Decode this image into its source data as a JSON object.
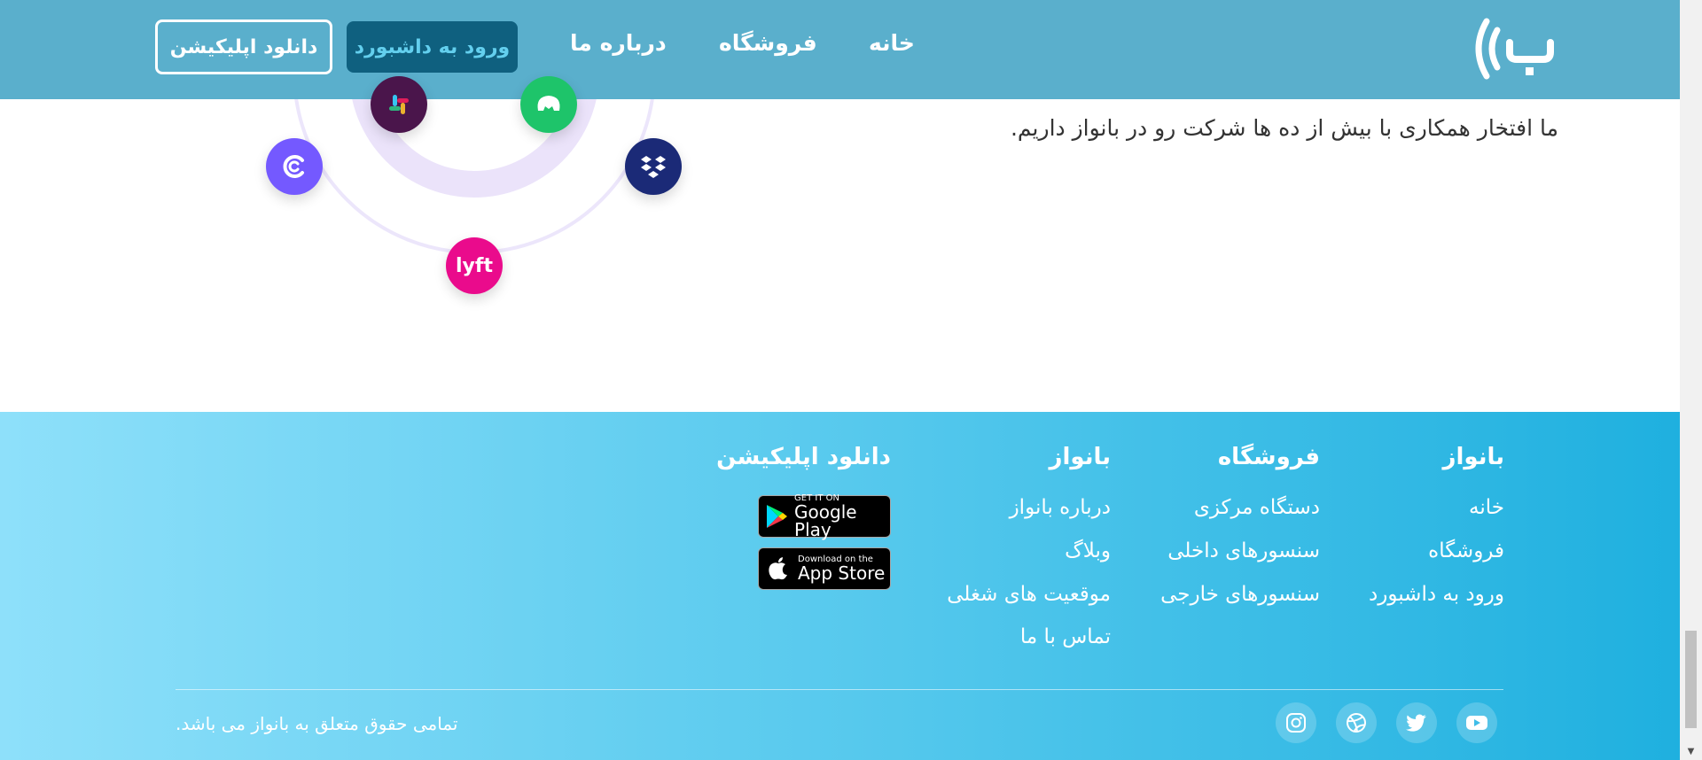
{
  "header": {
    "nav": [
      "خانه",
      "فروشگاه",
      "درباره ما"
    ],
    "dashboard_button": "ورود به داشبورد",
    "download_button": "دانلود اپلیکیشن"
  },
  "partners": {
    "text": "ما افتخار همکاری با بیش از ده ها شرکت رو در بانواز داریم.",
    "logos": [
      "slack-logo",
      "messenger-logo",
      "cachet-logo",
      "dropbox-logo",
      "lyft-logo"
    ]
  },
  "footer": {
    "columns": [
      {
        "title": "بانواز",
        "links": [
          "خانه",
          "فروشگاه",
          "ورود به داشبورد"
        ]
      },
      {
        "title": "فروشگاه",
        "links": [
          "دستگاه مرکزی",
          "سنسورهای داخلی",
          "سنسورهای خارجی"
        ]
      },
      {
        "title": "بانواز",
        "links": [
          "درباره بانواز",
          "وبلاگ",
          "موقعیت های شغلی",
          "تماس با ما"
        ]
      },
      {
        "title": "دانلود اپلیکیشن"
      }
    ],
    "google_play": {
      "small": "GET IT ON",
      "big": "Google Play"
    },
    "app_store": {
      "small": "Download on the",
      "big": "App Store"
    },
    "copyright": "تمامی حقوق متعلق به بانواز می باشد.",
    "social_icons": [
      "youtube-icon",
      "twitter-icon",
      "dribbble-icon",
      "instagram-icon"
    ]
  },
  "colors": {
    "header_bg": "#5aafcc",
    "dashboard_btn_bg": "#0f607f",
    "dashboard_btn_text": "#63cfee",
    "footer_gradient_start": "#1fb0df",
    "footer_gradient_end": "#8ee0fa"
  }
}
